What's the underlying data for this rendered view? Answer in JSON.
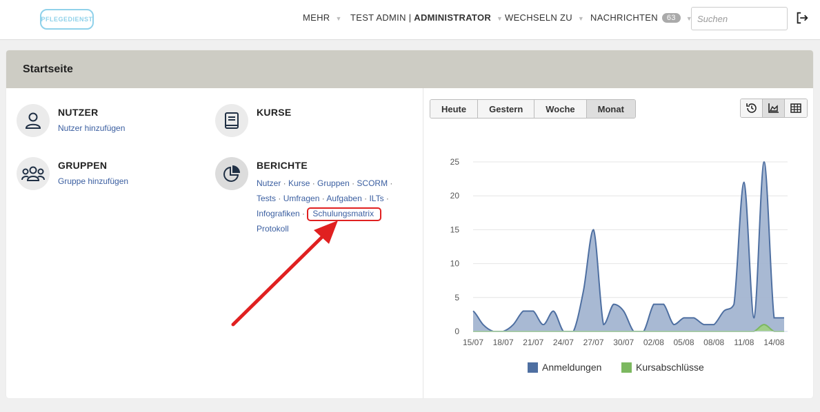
{
  "brand": {
    "logo_text": "PFLEGEDIENST"
  },
  "topnav": {
    "more_label": "MEHR",
    "user_name": "TEST ADMIN",
    "user_separator": " | ",
    "user_role": "ADMINISTRATOR",
    "switch_label": "WECHSELN ZU",
    "messages_label": "NACHRICHTEN",
    "messages_count": "63",
    "search_placeholder": "Suchen",
    "logout_icon": "logout-icon"
  },
  "page": {
    "title": "Startseite"
  },
  "tiles": {
    "users": {
      "title": "NUTZER",
      "link": "Nutzer hinzufügen",
      "icon": "user-icon"
    },
    "courses": {
      "title": "KURSE",
      "icon": "book-icon"
    },
    "groups": {
      "title": "GRUPPEN",
      "link": "Gruppe hinzufügen",
      "icon": "group-icon"
    },
    "reports": {
      "title": "BERICHTE",
      "icon": "pie-chart-icon",
      "links": [
        "Nutzer",
        "Kurse",
        "Gruppen",
        "SCORM",
        "Tests",
        "Umfragen",
        "Aufgaben",
        "ILTs",
        "Infografiken",
        "Schulungsmatrix",
        "Protokoll"
      ],
      "separator": "·",
      "highlighted": "Schulungsmatrix"
    }
  },
  "chart_panel": {
    "periods": [
      "Heute",
      "Gestern",
      "Woche",
      "Monat"
    ],
    "active_period": "Monat",
    "view_buttons": [
      "history-icon",
      "area-chart-icon",
      "table-icon"
    ],
    "active_view": "area-chart-icon"
  },
  "chart_data": {
    "type": "area",
    "x": [
      "15/07",
      "16/07",
      "17/07",
      "18/07",
      "19/07",
      "20/07",
      "21/07",
      "22/07",
      "23/07",
      "24/07",
      "25/07",
      "26/07",
      "27/07",
      "28/07",
      "29/07",
      "30/07",
      "31/07",
      "01/08",
      "02/08",
      "03/08",
      "04/08",
      "05/08",
      "06/08",
      "07/08",
      "08/08",
      "09/08",
      "10/08",
      "11/08",
      "12/08",
      "13/08",
      "14/08",
      "15/08"
    ],
    "x_tick_labels": [
      "15/07",
      "18/07",
      "21/07",
      "24/07",
      "27/07",
      "30/07",
      "02/08",
      "05/08",
      "08/08",
      "11/08",
      "14/08"
    ],
    "ylim": [
      0,
      25
    ],
    "y_ticks": [
      0,
      5,
      10,
      15,
      20,
      25
    ],
    "grid": true,
    "legend_position": "bottom",
    "series": [
      {
        "name": "Anmeldungen",
        "color": "#4e6fa1",
        "fill": "#a3b5d1",
        "values": [
          3,
          1,
          0,
          0,
          1,
          3,
          3,
          1,
          3,
          0,
          0,
          6,
          15,
          1,
          4,
          3,
          0,
          0,
          4,
          4,
          1,
          2,
          2,
          1,
          1,
          3,
          4,
          22,
          2,
          25,
          2,
          2
        ]
      },
      {
        "name": "Kursabschlüsse",
        "color": "#7cb860",
        "fill": "#9fcf85",
        "values": [
          0,
          0,
          0,
          0,
          0,
          0,
          0,
          0,
          0,
          0,
          0,
          0,
          0,
          0,
          0,
          0,
          0,
          0,
          0,
          0,
          0,
          0,
          0,
          0,
          0,
          0,
          0,
          0,
          0,
          1,
          0,
          0
        ]
      }
    ]
  },
  "colors": {
    "header_band": "#cdccc4",
    "link": "#3a5ea0",
    "annotation": "#e02020"
  }
}
